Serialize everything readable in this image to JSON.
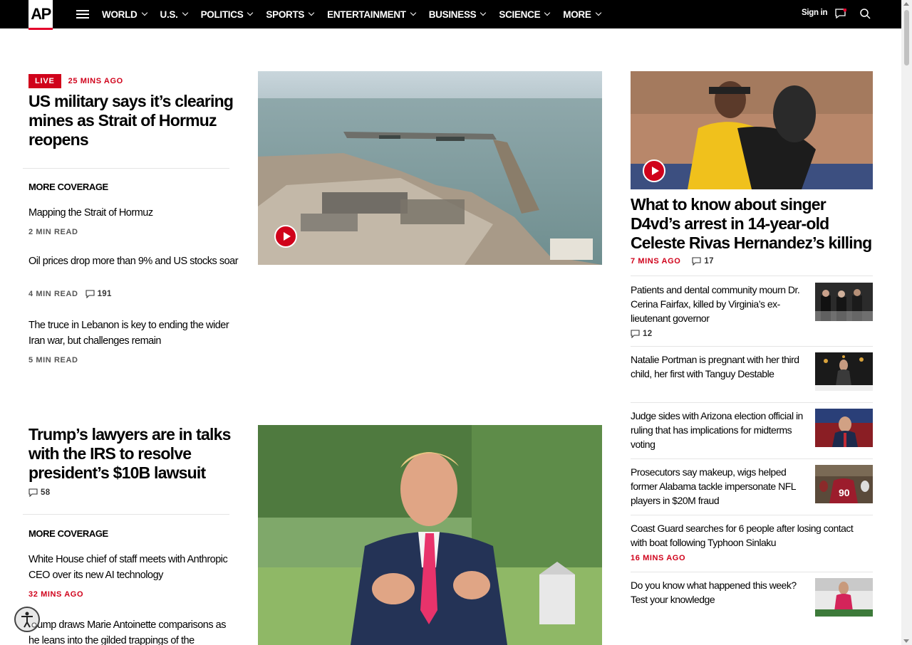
{
  "nav": {
    "logo": "AP",
    "items": [
      "WORLD",
      "U.S.",
      "POLITICS",
      "SPORTS",
      "ENTERTAINMENT",
      "BUSINESS",
      "SCIENCE",
      "MORE"
    ],
    "signin": "Sign in"
  },
  "lead": {
    "live": "LIVE",
    "time": "25 MINS AGO",
    "headline": "US military says it’s clearing mines as Strait of Hormuz reopens",
    "more_coverage": "MORE COVERAGE",
    "items": [
      {
        "title": "Mapping the Strait of Hormuz",
        "meta": "2 MIN READ",
        "comments": ""
      },
      {
        "title": "Oil prices drop more than 9% and US stocks soar",
        "meta": "4 MIN READ",
        "comments": "191"
      },
      {
        "title": "The truce in Lebanon is key to ending the wider Iran war, but challenges remain",
        "meta": "5 MIN READ",
        "comments": ""
      }
    ]
  },
  "second": {
    "headline": "Trump’s lawyers are in talks with the IRS to resolve president’s $10B lawsuit",
    "comments": "58",
    "more_coverage": "MORE COVERAGE",
    "items": [
      {
        "title": "White House chief of staff meets with Anthropic CEO over its new AI technology",
        "meta": "32 MINS AGO"
      },
      {
        "title": "Trump draws Marie Antoinette comparisons as he leans into the gilded trappings of the",
        "meta": ""
      }
    ]
  },
  "right": {
    "headline": "What to know about singer D4vd’s arrest in 14-year-old Celeste Rivas Hernandez’s killing",
    "time": "7 MINS AGO",
    "comments": "17",
    "items": [
      {
        "title": "Patients and dental community mourn Dr. Cerina Fairfax, killed by Virginia’s ex-lieutenant governor",
        "comments": "12",
        "meta": ""
      },
      {
        "title": "Natalie Portman is pregnant with her third child, her first with Tanguy Destable",
        "comments": "",
        "meta": ""
      },
      {
        "title": "Judge sides with Arizona election official in ruling that has implications for midterms voting",
        "comments": "",
        "meta": ""
      },
      {
        "title": "Prosecutors say makeup, wigs helped former Alabama tackle impersonate NFL players in $20M fraud",
        "comments": "",
        "meta": ""
      },
      {
        "title": "Coast Guard searches for 6 people after losing contact with boat following Typhoon Sinlaku",
        "comments": "",
        "meta": "16 MINS AGO"
      },
      {
        "title": "Do you know what happened this week? Test your knowledge",
        "comments": "",
        "meta": ""
      }
    ]
  },
  "colors": {
    "accent": "#d0021b",
    "nav_bg": "#000000"
  }
}
